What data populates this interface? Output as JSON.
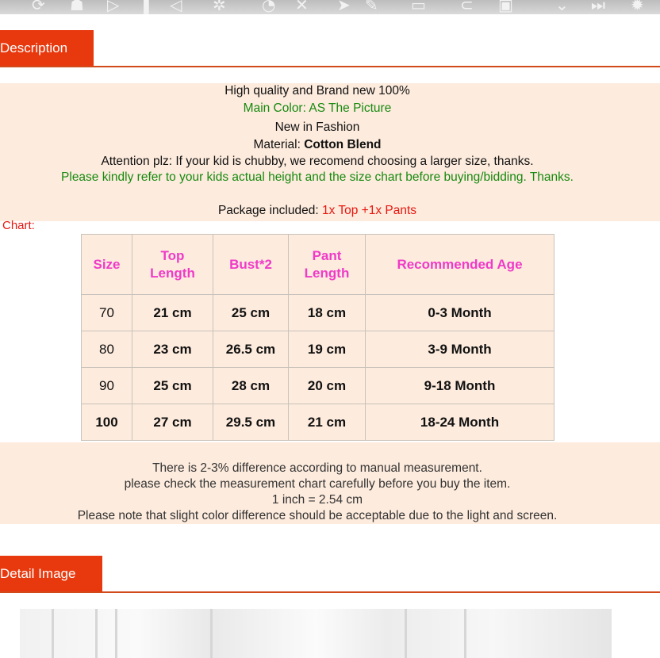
{
  "top_bar_icons": [
    "refresh-icon",
    "user-icon",
    "play-icon",
    "pause-icon",
    "rewind-icon",
    "gear-icon",
    "chart-icon",
    "close-icon",
    "send-icon",
    "edit-icon",
    "minus-icon",
    "attach-icon",
    "save-icon",
    "chevron-down-icon",
    "forward-icon",
    "settings-icon"
  ],
  "description": {
    "tab_label": "Description",
    "lines": {
      "l1": "High quality and Brand new 100%",
      "l2": "Main Color:  AS The Picture",
      "l3": "New in Fashion",
      "l4_prefix": "Material: ",
      "l4_value": "Cotton Blend",
      "l5": "Attention plz: If your kid is chubby, we recomend choosing a larger size, thanks.",
      "l6": "Please kindly refer to your kids actual height and the size chart before buying/bidding. Thanks.",
      "l7_prefix": "Package included: ",
      "l7_value": "1x Top +1x Pants"
    },
    "chart_label": "Chart:"
  },
  "size_table": {
    "headers": [
      "Size",
      "Top Length",
      "Bust*2",
      "Pant Length",
      "Recommended Age"
    ],
    "rows": [
      [
        "70",
        "21 cm",
        "25 cm",
        "18 cm",
        "0-3 Month"
      ],
      [
        "80",
        "23 cm",
        "26.5 cm",
        "19 cm",
        "3-9 Month"
      ],
      [
        "90",
        "25 cm",
        "28 cm",
        "20 cm",
        "9-18 Month"
      ],
      [
        "100",
        "27 cm",
        "29.5 cm",
        "21 cm",
        "18-24 Month"
      ]
    ]
  },
  "notes": {
    "n1": "There is 2-3% difference according to manual measurement.",
    "n2": "please check the measurement chart carefully before you buy the item.",
    "n3": "1 inch = 2.54 cm",
    "n4": "Please note that slight color difference should be acceptable due to the light and screen."
  },
  "detail": {
    "tab_label": "Detail Image"
  },
  "colors": {
    "accent": "#e8390e",
    "band": "#fdebdd",
    "header_text": "#f03ac8",
    "green": "#178a10",
    "red": "#e8170f"
  }
}
